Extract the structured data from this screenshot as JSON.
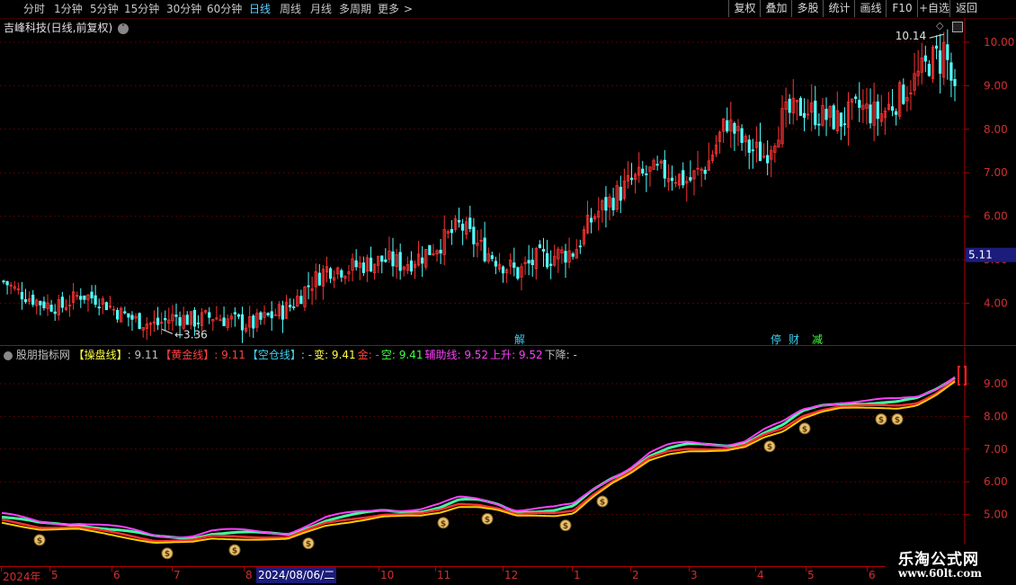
{
  "toolbar": {
    "periods": [
      "分时",
      "1分钟",
      "5分钟",
      "15分钟",
      "30分钟",
      "60分钟",
      "日线",
      "周线",
      "月线",
      "多周期",
      "更多"
    ],
    "active": "日线",
    "more_arrow": ">",
    "right_buttons": [
      "复权",
      "叠加",
      "多股",
      "统计",
      "画线",
      "F10",
      "+自选",
      "返回"
    ]
  },
  "main_chart": {
    "title": "吉峰科技(日线,前复权)",
    "y_ticks": [
      "10.00",
      "9.00",
      "8.00",
      "7.00",
      "6.00",
      "5.00",
      "4.00"
    ],
    "current_price": "5.11",
    "high_label": "10.14",
    "low_label": "3.36",
    "markers": [
      {
        "text": "解",
        "color": "#3ad0f0"
      },
      {
        "text": "停",
        "color": "#3ad0f0"
      },
      {
        "text": "财",
        "color": "#3ad0f0"
      },
      {
        "text": "减",
        "color": "#40ff40"
      }
    ]
  },
  "indicator": {
    "name": "股朋指标网",
    "items": [
      {
        "label": "【操盘线】",
        "value": ": 9.11",
        "label_color": "#ffff40",
        "value_color": "#c0c0c0"
      },
      {
        "label": "【黄金线】",
        "value": ": 9.11",
        "label_color": "#ff4040",
        "value_color": "#ff4040"
      },
      {
        "label": "【空仓线】",
        "value": ": -",
        "label_color": "#3ad0f0",
        "value_color": "#c0c0c0"
      },
      {
        "label": "变",
        "value": ": 9.41",
        "label_color": "#ffff40",
        "value_color": "#ffff40"
      },
      {
        "label": "金",
        "value": ": -",
        "label_color": "#ff4040",
        "value_color": "#ff4040"
      },
      {
        "label": "空",
        "value": ": 9.41",
        "label_color": "#40ff40",
        "value_color": "#40ff40"
      },
      {
        "label": "辅助线",
        "value": ": 9.52",
        "label_color": "#ff40ff",
        "value_color": "#ff40ff"
      },
      {
        "label": "上升",
        "value": ": 9.52",
        "label_color": "#ff40ff",
        "value_color": "#ff40ff"
      },
      {
        "label": "下降",
        "value": ": -",
        "label_color": "#c0c0c0",
        "value_color": "#c0c0c0"
      }
    ],
    "y_ticks": [
      "9.00",
      "8.00",
      "7.00",
      "6.00",
      "5.00"
    ],
    "coin_symbol": "$"
  },
  "x_axis": {
    "labels": [
      "2024年",
      "5",
      "6",
      "7",
      "8",
      "2024/08/06/二",
      "10",
      "11",
      "12",
      "1",
      "2",
      "3",
      "4",
      "5",
      "6"
    ],
    "crosshair_date": "2024/08/06/二"
  },
  "watermark": {
    "line1": "乐淘公式网",
    "line2": "www.60lt.com"
  },
  "chart_data": [
    {
      "type": "candlestick",
      "title": "吉峰科技(日线,前复权)",
      "y_ticks": [
        4,
        5,
        6,
        7,
        8,
        9,
        10
      ],
      "ylim": [
        3.0,
        11.0
      ],
      "approx_close_path": [
        4.5,
        4.2,
        4.0,
        3.9,
        4.2,
        4.1,
        3.8,
        3.6,
        3.5,
        3.7,
        3.6,
        3.7,
        3.6,
        3.5,
        3.7,
        3.9,
        4.4,
        4.8,
        4.8,
        4.9,
        5.0,
        4.9,
        5.1,
        5.4,
        5.8,
        5.3,
        5.0,
        4.7,
        5.0,
        5.1,
        5.2,
        6.0,
        6.4,
        6.8,
        7.0,
        7.0,
        6.8,
        7.2,
        8.2,
        7.6,
        7.4,
        8.3,
        8.5,
        8.3,
        8.2,
        8.5,
        8.3,
        8.7,
        9.2,
        9.7,
        9.0
      ],
      "high": 10.14,
      "low": 3.36,
      "last": 5.11,
      "up_color": "#ff3232",
      "down_color": "#54fcfc"
    },
    {
      "type": "line",
      "y_ticks": [
        5,
        6,
        7,
        8,
        9
      ],
      "ylim": [
        4.1,
        9.9
      ],
      "series": [
        {
          "name": "操盘线",
          "color": "#ffff40"
        },
        {
          "name": "黄金线",
          "color": "#ff4040"
        },
        {
          "name": "空仓线",
          "color": "#3ad0f0"
        },
        {
          "name": "辅助线",
          "color": "#ff40ff"
        }
      ],
      "approx_path": [
        4.8,
        4.7,
        4.6,
        4.6,
        4.6,
        4.5,
        4.4,
        4.3,
        4.2,
        4.2,
        4.2,
        4.3,
        4.3,
        4.3,
        4.3,
        4.3,
        4.5,
        4.7,
        4.8,
        4.9,
        5.0,
        5.0,
        5.0,
        5.1,
        5.3,
        5.3,
        5.2,
        5.0,
        5.0,
        5.0,
        5.1,
        5.6,
        6.0,
        6.3,
        6.7,
        6.9,
        7.0,
        7.0,
        7.0,
        7.1,
        7.4,
        7.6,
        8.0,
        8.2,
        8.3,
        8.3,
        8.3,
        8.3,
        8.4,
        8.7,
        9.1
      ]
    }
  ]
}
